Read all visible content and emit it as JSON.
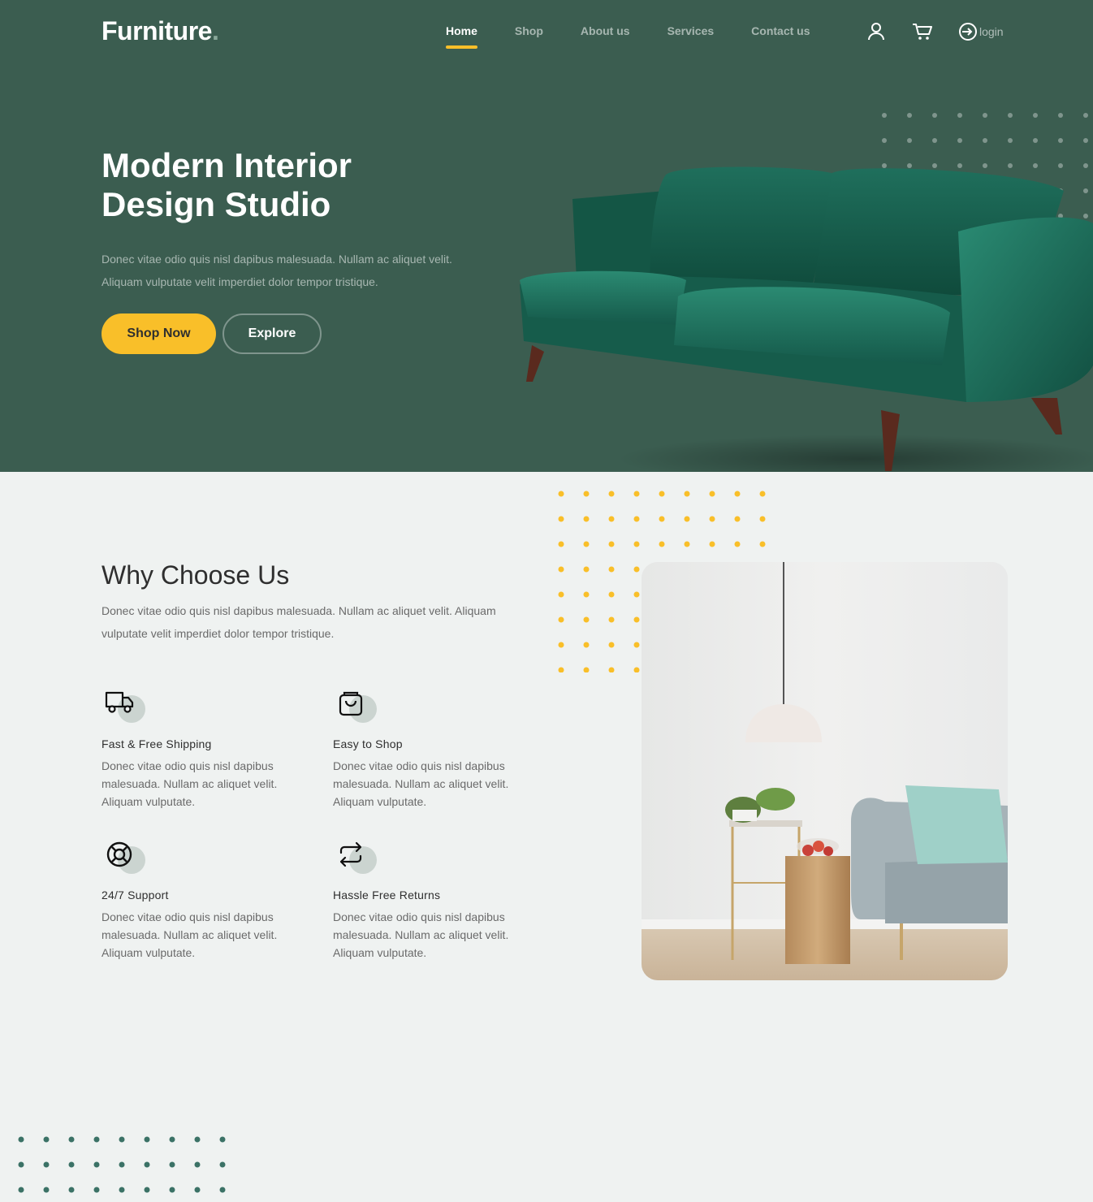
{
  "header": {
    "logo_text": "Furniture",
    "logo_dot": ".",
    "nav": [
      {
        "label": "Home",
        "active": true
      },
      {
        "label": "Shop",
        "active": false
      },
      {
        "label": "About us",
        "active": false
      },
      {
        "label": "Services",
        "active": false
      },
      {
        "label": "Contact us",
        "active": false
      }
    ],
    "icons": [
      "user-icon",
      "cart-icon",
      "login-icon"
    ],
    "login_label": "login"
  },
  "hero": {
    "title_line1": "Modern Interior",
    "title_line2": "Design Studio",
    "description": "Donec vitae odio quis nisl dapibus malesuada. Nullam ac aliquet velit. Aliquam vulputate velit imperdiet dolor tempor tristique.",
    "primary_button": "Shop Now",
    "secondary_button": "Explore"
  },
  "why": {
    "title": "Why Choose Us",
    "description": "Donec vitae odio quis nisl dapibus malesuada. Nullam ac aliquet velit. Aliquam vulputate velit imperdiet dolor tempor tristique.",
    "features": [
      {
        "icon": "truck-icon",
        "title": "Fast & Free Shipping",
        "text": "Donec vitae odio quis nisl dapibus malesuada. Nullam ac aliquet velit. Aliquam vulputate."
      },
      {
        "icon": "bag-icon",
        "title": "Easy to Shop",
        "text": "Donec vitae odio quis nisl dapibus malesuada. Nullam ac aliquet velit. Aliquam vulputate."
      },
      {
        "icon": "support-icon",
        "title": "24/7 Support",
        "text": "Donec vitae odio quis nisl dapibus malesuada. Nullam ac aliquet velit. Aliquam vulputate."
      },
      {
        "icon": "return-icon",
        "title": "Hassle Free Returns",
        "text": "Donec vitae odio quis nisl dapibus malesuada. Nullam ac aliquet velit. Aliquam vulputate."
      }
    ]
  },
  "colors": {
    "brand_green": "#3b5d50",
    "accent_yellow": "#f9bf29",
    "page_bg": "#eff2f1"
  }
}
